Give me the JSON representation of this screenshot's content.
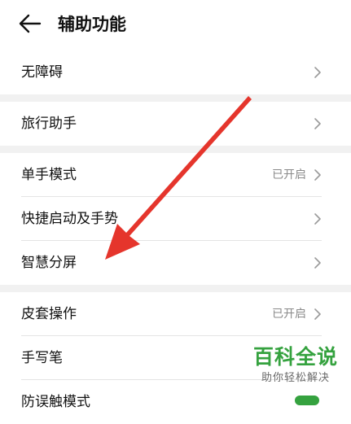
{
  "header": {
    "title": "辅助功能",
    "back_icon": "arrow-left-icon"
  },
  "groups": [
    {
      "rows": [
        {
          "label": "无障碍",
          "value": ""
        }
      ]
    },
    {
      "rows": [
        {
          "label": "旅行助手",
          "value": ""
        }
      ]
    },
    {
      "rows": [
        {
          "label": "单手模式",
          "value": "已开启"
        },
        {
          "label": "快捷启动及手势",
          "value": ""
        },
        {
          "label": "智慧分屏",
          "value": ""
        }
      ]
    },
    {
      "rows": [
        {
          "label": "皮套操作",
          "value": "已开启"
        },
        {
          "label": "手写笔",
          "value": ""
        },
        {
          "label": "防误触模式",
          "value": ""
        }
      ]
    }
  ],
  "watermark": {
    "title": "百科全说",
    "subtitle": "助你轻松解决"
  },
  "colors": {
    "background": "#f1f1f1",
    "card": "#ffffff",
    "arrow": "#e5352c",
    "watermark_green": "#35a23f"
  }
}
